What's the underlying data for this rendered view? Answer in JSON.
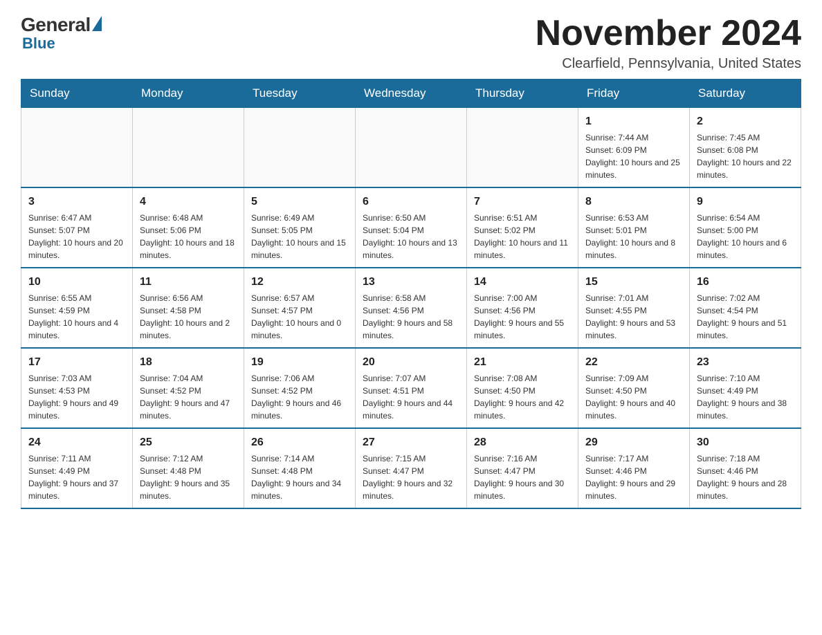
{
  "header": {
    "logo": {
      "general": "General",
      "blue": "Blue"
    },
    "title": "November 2024",
    "location": "Clearfield, Pennsylvania, United States"
  },
  "days_of_week": [
    "Sunday",
    "Monday",
    "Tuesday",
    "Wednesday",
    "Thursday",
    "Friday",
    "Saturday"
  ],
  "weeks": [
    [
      {
        "day": "",
        "sunrise": "",
        "sunset": "",
        "daylight": ""
      },
      {
        "day": "",
        "sunrise": "",
        "sunset": "",
        "daylight": ""
      },
      {
        "day": "",
        "sunrise": "",
        "sunset": "",
        "daylight": ""
      },
      {
        "day": "",
        "sunrise": "",
        "sunset": "",
        "daylight": ""
      },
      {
        "day": "",
        "sunrise": "",
        "sunset": "",
        "daylight": ""
      },
      {
        "day": "1",
        "sunrise": "Sunrise: 7:44 AM",
        "sunset": "Sunset: 6:09 PM",
        "daylight": "Daylight: 10 hours and 25 minutes."
      },
      {
        "day": "2",
        "sunrise": "Sunrise: 7:45 AM",
        "sunset": "Sunset: 6:08 PM",
        "daylight": "Daylight: 10 hours and 22 minutes."
      }
    ],
    [
      {
        "day": "3",
        "sunrise": "Sunrise: 6:47 AM",
        "sunset": "Sunset: 5:07 PM",
        "daylight": "Daylight: 10 hours and 20 minutes."
      },
      {
        "day": "4",
        "sunrise": "Sunrise: 6:48 AM",
        "sunset": "Sunset: 5:06 PM",
        "daylight": "Daylight: 10 hours and 18 minutes."
      },
      {
        "day": "5",
        "sunrise": "Sunrise: 6:49 AM",
        "sunset": "Sunset: 5:05 PM",
        "daylight": "Daylight: 10 hours and 15 minutes."
      },
      {
        "day": "6",
        "sunrise": "Sunrise: 6:50 AM",
        "sunset": "Sunset: 5:04 PM",
        "daylight": "Daylight: 10 hours and 13 minutes."
      },
      {
        "day": "7",
        "sunrise": "Sunrise: 6:51 AM",
        "sunset": "Sunset: 5:02 PM",
        "daylight": "Daylight: 10 hours and 11 minutes."
      },
      {
        "day": "8",
        "sunrise": "Sunrise: 6:53 AM",
        "sunset": "Sunset: 5:01 PM",
        "daylight": "Daylight: 10 hours and 8 minutes."
      },
      {
        "day": "9",
        "sunrise": "Sunrise: 6:54 AM",
        "sunset": "Sunset: 5:00 PM",
        "daylight": "Daylight: 10 hours and 6 minutes."
      }
    ],
    [
      {
        "day": "10",
        "sunrise": "Sunrise: 6:55 AM",
        "sunset": "Sunset: 4:59 PM",
        "daylight": "Daylight: 10 hours and 4 minutes."
      },
      {
        "day": "11",
        "sunrise": "Sunrise: 6:56 AM",
        "sunset": "Sunset: 4:58 PM",
        "daylight": "Daylight: 10 hours and 2 minutes."
      },
      {
        "day": "12",
        "sunrise": "Sunrise: 6:57 AM",
        "sunset": "Sunset: 4:57 PM",
        "daylight": "Daylight: 10 hours and 0 minutes."
      },
      {
        "day": "13",
        "sunrise": "Sunrise: 6:58 AM",
        "sunset": "Sunset: 4:56 PM",
        "daylight": "Daylight: 9 hours and 58 minutes."
      },
      {
        "day": "14",
        "sunrise": "Sunrise: 7:00 AM",
        "sunset": "Sunset: 4:56 PM",
        "daylight": "Daylight: 9 hours and 55 minutes."
      },
      {
        "day": "15",
        "sunrise": "Sunrise: 7:01 AM",
        "sunset": "Sunset: 4:55 PM",
        "daylight": "Daylight: 9 hours and 53 minutes."
      },
      {
        "day": "16",
        "sunrise": "Sunrise: 7:02 AM",
        "sunset": "Sunset: 4:54 PM",
        "daylight": "Daylight: 9 hours and 51 minutes."
      }
    ],
    [
      {
        "day": "17",
        "sunrise": "Sunrise: 7:03 AM",
        "sunset": "Sunset: 4:53 PM",
        "daylight": "Daylight: 9 hours and 49 minutes."
      },
      {
        "day": "18",
        "sunrise": "Sunrise: 7:04 AM",
        "sunset": "Sunset: 4:52 PM",
        "daylight": "Daylight: 9 hours and 47 minutes."
      },
      {
        "day": "19",
        "sunrise": "Sunrise: 7:06 AM",
        "sunset": "Sunset: 4:52 PM",
        "daylight": "Daylight: 9 hours and 46 minutes."
      },
      {
        "day": "20",
        "sunrise": "Sunrise: 7:07 AM",
        "sunset": "Sunset: 4:51 PM",
        "daylight": "Daylight: 9 hours and 44 minutes."
      },
      {
        "day": "21",
        "sunrise": "Sunrise: 7:08 AM",
        "sunset": "Sunset: 4:50 PM",
        "daylight": "Daylight: 9 hours and 42 minutes."
      },
      {
        "day": "22",
        "sunrise": "Sunrise: 7:09 AM",
        "sunset": "Sunset: 4:50 PM",
        "daylight": "Daylight: 9 hours and 40 minutes."
      },
      {
        "day": "23",
        "sunrise": "Sunrise: 7:10 AM",
        "sunset": "Sunset: 4:49 PM",
        "daylight": "Daylight: 9 hours and 38 minutes."
      }
    ],
    [
      {
        "day": "24",
        "sunrise": "Sunrise: 7:11 AM",
        "sunset": "Sunset: 4:49 PM",
        "daylight": "Daylight: 9 hours and 37 minutes."
      },
      {
        "day": "25",
        "sunrise": "Sunrise: 7:12 AM",
        "sunset": "Sunset: 4:48 PM",
        "daylight": "Daylight: 9 hours and 35 minutes."
      },
      {
        "day": "26",
        "sunrise": "Sunrise: 7:14 AM",
        "sunset": "Sunset: 4:48 PM",
        "daylight": "Daylight: 9 hours and 34 minutes."
      },
      {
        "day": "27",
        "sunrise": "Sunrise: 7:15 AM",
        "sunset": "Sunset: 4:47 PM",
        "daylight": "Daylight: 9 hours and 32 minutes."
      },
      {
        "day": "28",
        "sunrise": "Sunrise: 7:16 AM",
        "sunset": "Sunset: 4:47 PM",
        "daylight": "Daylight: 9 hours and 30 minutes."
      },
      {
        "day": "29",
        "sunrise": "Sunrise: 7:17 AM",
        "sunset": "Sunset: 4:46 PM",
        "daylight": "Daylight: 9 hours and 29 minutes."
      },
      {
        "day": "30",
        "sunrise": "Sunrise: 7:18 AM",
        "sunset": "Sunset: 4:46 PM",
        "daylight": "Daylight: 9 hours and 28 minutes."
      }
    ]
  ]
}
